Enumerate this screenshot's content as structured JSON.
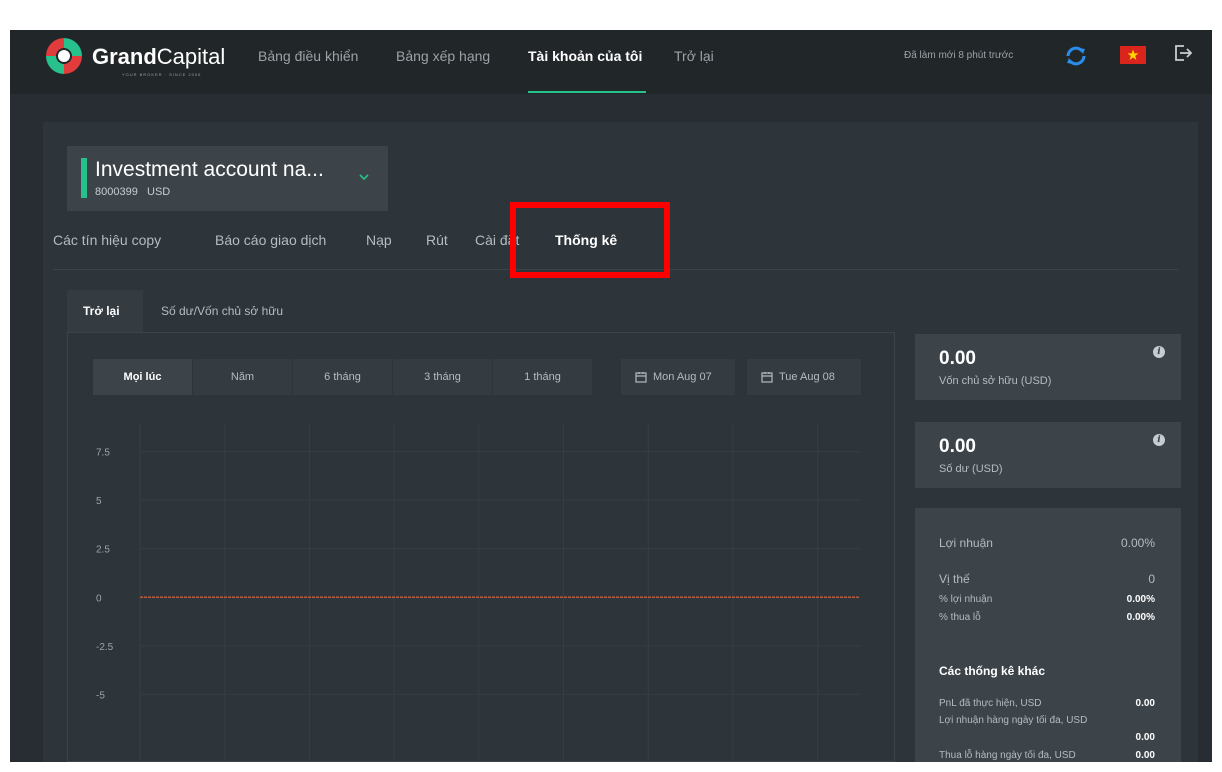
{
  "brand": {
    "name_bold": "Grand",
    "name_light": "Capital",
    "tagline": "YOUR BROKER · SINCE 2006"
  },
  "nav": {
    "items": [
      "Bảng điều khiển",
      "Bảng xếp hạng",
      "Tài khoản của tôi",
      "Trở lại"
    ],
    "active_index": 2,
    "refresh_text": "Đã làm mới 8 phút trước"
  },
  "account": {
    "name": "Investment account na...",
    "number": "8000399",
    "currency": "USD"
  },
  "subtabs": {
    "items": [
      "Các tín hiệu copy",
      "Báo cáo giao dịch",
      "Nạp",
      "Rút",
      "Cài đặt",
      "Thống kê"
    ],
    "active": "Thống kê"
  },
  "chart_tabs": {
    "items": [
      "Trở lại",
      "Số dư/Vốn chủ sở hữu"
    ],
    "active": "Trở lại"
  },
  "periods": {
    "items": [
      "Mọi lúc",
      "Năm",
      "6 tháng",
      "3 tháng",
      "1 tháng"
    ],
    "active": "Mọi lúc"
  },
  "dates": {
    "from": "Mon Aug 07",
    "to": "Tue Aug 08"
  },
  "chart_data": {
    "type": "line",
    "y_ticks": [
      7.5,
      5,
      2.5,
      0,
      -2.5,
      -5
    ],
    "series": [
      {
        "values": [
          0,
          0
        ]
      }
    ],
    "grid": true,
    "colors": {
      "line": "#b85a3e"
    }
  },
  "stats": {
    "equity": {
      "value": "0.00",
      "label": "Vốn chủ sở hữu (USD)"
    },
    "balance": {
      "value": "0.00",
      "label": "Số dư (USD)"
    },
    "profit": {
      "label": "Lợi nhuận",
      "value": "0.00%"
    },
    "positions": {
      "label": "Vị thế",
      "value": "0"
    },
    "pct_profit": {
      "label": "% lợi nhuận",
      "value": "0.00%"
    },
    "pct_loss": {
      "label": "% thua lỗ",
      "value": "0.00%"
    },
    "other_title": "Các thống kê khác",
    "realized_pnl": {
      "label": "PnL đã thực hiện, USD",
      "value": "0.00"
    },
    "max_daily_profit": {
      "label": "Lợi nhuận hàng ngày tối đa, USD",
      "value": "0.00"
    },
    "max_daily_loss": {
      "label": "Thua lỗ hàng ngày tối đa, USD",
      "value": "0.00"
    }
  },
  "colors": {
    "accent": "#27c18c",
    "highlight": "#ff0000",
    "background": "#272d32"
  }
}
